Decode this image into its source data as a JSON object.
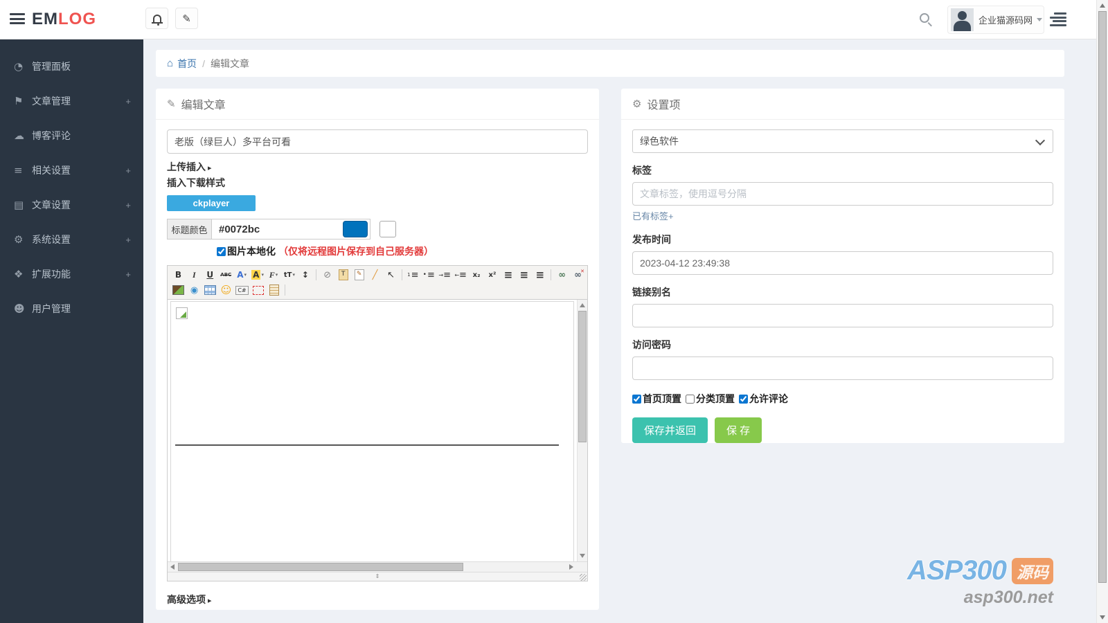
{
  "header": {
    "logo_em": "EM",
    "logo_log": "LOG",
    "user_name": "企业猫源码网"
  },
  "sidebar": {
    "items": [
      {
        "label": "管理面板",
        "icon": "dashboard-icon",
        "plus": ""
      },
      {
        "label": "文章管理",
        "icon": "bookmark-icon",
        "plus": "+"
      },
      {
        "label": "博客评论",
        "icon": "comments-icon",
        "plus": ""
      },
      {
        "label": "相关设置",
        "icon": "sliders-icon",
        "plus": "+"
      },
      {
        "label": "文章设置",
        "icon": "list-box-icon",
        "plus": "+"
      },
      {
        "label": "系统设置",
        "icon": "gear-icon",
        "plus": "+"
      },
      {
        "label": "扩展功能",
        "icon": "puzzle-icon",
        "plus": "+"
      },
      {
        "label": "用户管理",
        "icon": "users-icon",
        "plus": ""
      }
    ]
  },
  "breadcrumb": {
    "home": "首页",
    "separator": "/",
    "current": "编辑文章"
  },
  "editor_panel": {
    "title": "编辑文章",
    "post_title_value": "老版（绿巨人）多平台可看",
    "upload_insert": "上传插入",
    "insert_download_style": "插入下载样式",
    "ckplayer_label": "ckplayer",
    "title_color_label": "标题颜色",
    "title_color_value": "#0072bc",
    "localize_label": "图片本地化",
    "localize_note": "（仅将远程图片保存到自己服务器）",
    "advanced_options": "高级选项",
    "toolbar_row1": [
      "bold-icon",
      "italic-icon",
      "underline-icon",
      "strikethrough-icon",
      "forecolor-icon",
      "hilite-color-icon",
      "font-name-icon",
      "font-size-icon",
      "line-height-icon",
      "separator",
      "remove-format-icon",
      "paste-text-icon",
      "paste-word-icon",
      "clear-html-icon",
      "select-all-icon",
      "separator",
      "ordered-list-icon",
      "unordered-list-icon",
      "indent-icon",
      "outdent-icon",
      "subscript-icon",
      "superscript-icon",
      "align-left-icon",
      "align-center-icon",
      "align-right-icon",
      "separator",
      "link-icon",
      "unlink-icon"
    ],
    "toolbar_row2": [
      "image-icon",
      "media-icon",
      "table-icon",
      "emoticon-icon",
      "code-icon",
      "screenshot-icon",
      "note-icon",
      "separator"
    ]
  },
  "settings_panel": {
    "title": "设置项",
    "category_selected": "绿色软件",
    "tag_label": "标签",
    "tag_placeholder": "文章标签，使用逗号分隔",
    "existing_tags_link": "已有标签+",
    "publish_time_label": "发布时间",
    "publish_time_value": "2023-04-12 23:49:38",
    "alias_label": "链接别名",
    "password_label": "访问密码",
    "checkboxes": [
      {
        "label": "首页顶置",
        "checked": true
      },
      {
        "label": "分类顶置",
        "checked": false
      },
      {
        "label": "允许评论",
        "checked": true
      }
    ],
    "save_return_label": "保存并返回",
    "save_label": "保 存"
  },
  "watermark": {
    "brand": "ASP300",
    "badge": "源码",
    "domain": "asp300.net"
  },
  "colors": {
    "accent_title_color": "#0072bc",
    "ckplayer_blue": "#3aa9e0",
    "save_teal": "#3cc2ae",
    "save_green": "#87c94b",
    "logo_red": "#ef5350",
    "sidebar_bg": "#2a3542",
    "note_red": "#e23b3b"
  }
}
